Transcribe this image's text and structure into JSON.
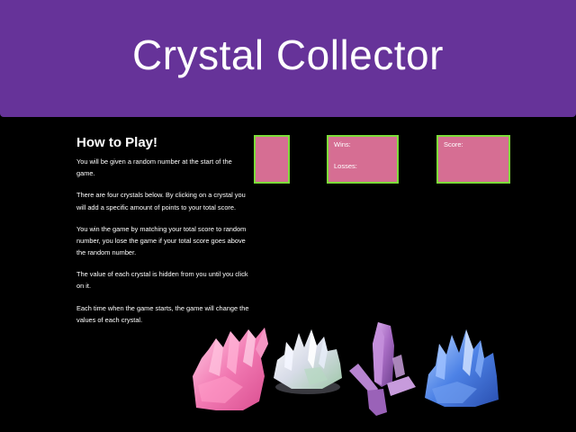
{
  "header": {
    "title": "Crystal Collector",
    "background_color": "#663399"
  },
  "how_to": {
    "title": "How to Play!",
    "paragraphs": [
      "You will be given a random number at the start of the game.",
      "There are four crystals below. By clicking on a crystal you will add a specific amount of points to your total score.",
      "You win the game by matching your total score to random number, you lose the game if your total score goes above the random number.",
      "The value of each crystal is hidden from you until you click on it.",
      "Each time when the game starts, the game will change the values of each crystal."
    ]
  },
  "boxes": {
    "fill_color": "#d66e93",
    "border_color": "#7ddc3a",
    "wins_label": "Wins:",
    "losses_label": "Losses:",
    "score_label": "Score:"
  },
  "crystals": [
    {
      "name": "pink-crystal",
      "color": "#f07ab0"
    },
    {
      "name": "white-crystal",
      "color": "#e8e8ef"
    },
    {
      "name": "purple-crystal",
      "color": "#b07ac8"
    },
    {
      "name": "blue-crystal",
      "color": "#4a7fe0"
    }
  ]
}
